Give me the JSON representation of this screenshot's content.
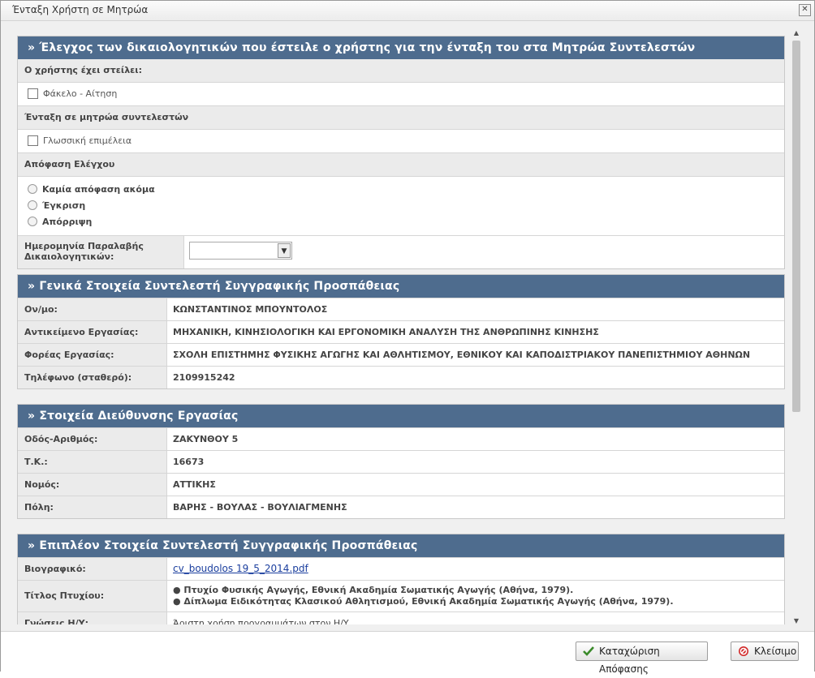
{
  "window": {
    "title": "Ένταξη Χρήστη σε Μητρώα",
    "close_glyph": "✕"
  },
  "check_section": {
    "header": "» Έλεγχος των δικαιολογητικών που έστειλε ο χρήστης για την ένταξη του στα Μητρώα Συντελεστών",
    "sent_label": "Ο χρήστης έχει στείλει:",
    "sent_items": [
      "Φάκελο - Αίτηση"
    ],
    "registry_label": "Ένταξη σε μητρώα συντελεστών",
    "registry_items": [
      "Γλωσσική επιμέλεια"
    ],
    "decision_label": "Απόφαση Ελέγχου",
    "decision_options": [
      "Καμία απόφαση ακόμα",
      "Έγκριση",
      "Απόρριψη"
    ],
    "date_label": "Ημερομηνία Παραλαβής Δικαιολογητικών:",
    "date_value": ""
  },
  "general_section": {
    "header": "» Γενικά Στοιχεία Συντελεστή Συγγραφικής Προσπάθειας",
    "rows": [
      {
        "label": "Ον/μο:",
        "value": "ΚΩΝΣΤΑΝΤΙΝΟΣ ΜΠΟΥΝΤΟΛΟΣ"
      },
      {
        "label": "Αντικείμενο Εργασίας:",
        "value": "ΜΗΧΑΝΙΚΗ, ΚΙΝΗΣΙΟΛΟΓΙΚΗ ΚΑΙ ΕΡΓΟΝΟΜΙΚΗ ΑΝΑΛΥΣΗ ΤΗΣ ΑΝΘΡΩΠΙΝΗΣ ΚΙΝΗΣΗΣ"
      },
      {
        "label": "Φορέας Εργασίας:",
        "value": "ΣΧΟΛΗ ΕΠΙΣΤΗΜΗΣ ΦΥΣΙΚΗΣ ΑΓΩΓΗΣ ΚΑΙ ΑΘΛΗΤΙΣΜΟΥ, ΕΘΝΙΚΟΥ ΚΑΙ ΚΑΠΟΔΙΣΤΡΙΑΚΟΥ ΠΑΝΕΠΙΣΤΗΜΙΟΥ ΑΘΗΝΩΝ"
      },
      {
        "label": "Τηλέφωνο (σταθερό):",
        "value": "2109915242"
      }
    ]
  },
  "address_section": {
    "header": "» Στοιχεία Διεύθυνσης Εργασίας",
    "rows": [
      {
        "label": "Οδός-Αριθμός:",
        "value": "ΖΑΚΥΝΘΟΥ 5"
      },
      {
        "label": "Τ.Κ.:",
        "value": "16673"
      },
      {
        "label": "Νομός:",
        "value": "ΑΤΤΙΚΗΣ"
      },
      {
        "label": "Πόλη:",
        "value": "ΒΑΡΗΣ - ΒΟΥΛΑΣ - ΒΟΥΛΙΑΓΜΕΝΗΣ"
      }
    ]
  },
  "extra_section": {
    "header": "» Επιπλέον Στοιχεία Συντελεστή Συγγραφικής Προσπάθειας",
    "cv_label": "Βιογραφικό:",
    "cv_link": "cv_boudolos 19_5_2014.pdf",
    "degree_label": "Τίτλος Πτυχίου:",
    "degree_lines": [
      "● Πτυχίο Φυσικής Αγωγής, Εθνική Ακαδημία Σωματικής Αγωγής (Αθήνα, 1979).",
      "● Δίπλωμα Ειδικότητας Κλασικού Αθλητισμού, Εθνική Ακαδημία Σωματικής Αγωγής (Αθήνα, 1979)."
    ],
    "pc_label": "Γνώσεις Η/Υ:",
    "pc_value": "Άριστη χρήση προγραμμάτων στον Η/Υ"
  },
  "footer": {
    "save_label": "Καταχώριση Απόφασης",
    "close_label": "Κλείσιμο"
  },
  "colors": {
    "header_bg": "#4e6c8e",
    "save_icon": "#3a8a2a",
    "close_icon": "#d22a2a",
    "link": "#1a3e9e"
  }
}
